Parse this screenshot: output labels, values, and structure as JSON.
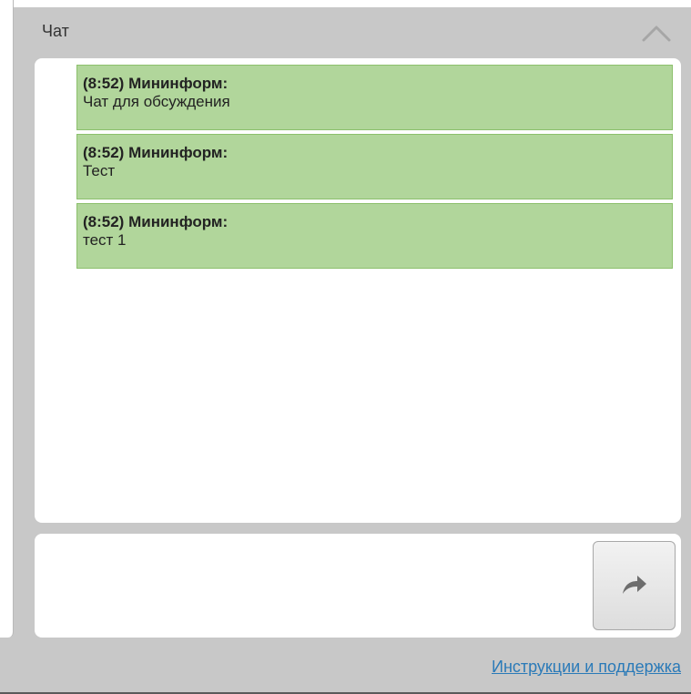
{
  "chat": {
    "title": "Чат",
    "messages": [
      {
        "time": "(8:52)",
        "author": "Мининформ:",
        "text": "Чат для обсуждения"
      },
      {
        "time": "(8:52)",
        "author": "Мининформ:",
        "text": "Тест"
      },
      {
        "time": "(8:52)",
        "author": "Мининформ:",
        "text": "тест 1"
      }
    ],
    "input": {
      "value": ""
    }
  },
  "footer": {
    "support_link": "Инструкции и поддержка"
  },
  "colors": {
    "message_bg": "#b1d69b",
    "message_border": "#8cc06c",
    "panel_bg": "#c8c8c8",
    "link": "#2a7ab8"
  },
  "icons": {
    "collapse": "chevron-up-icon",
    "send": "share-arrow-icon"
  }
}
